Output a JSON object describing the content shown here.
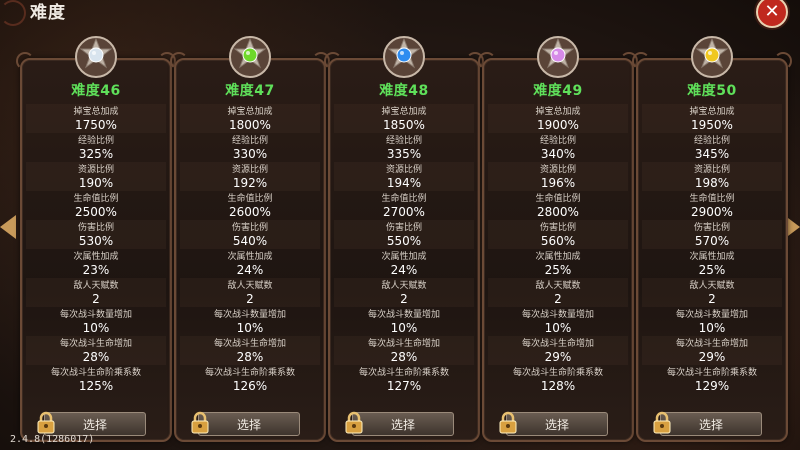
{
  "header": {
    "title": "难度"
  },
  "version": "2.4.8(1286017)",
  "select_label": "选择",
  "cards": [
    {
      "level": "难度46",
      "gem_color": "#d8e4ee",
      "rows": [
        {
          "label": "掉宝总加成",
          "value": "1750%"
        },
        {
          "label": "经验比例",
          "value": "325%"
        },
        {
          "label": "资源比例",
          "value": "190%"
        },
        {
          "label": "生命值比例",
          "value": "2500%"
        },
        {
          "label": "伤害比例",
          "value": "530%"
        },
        {
          "label": "次属性加成",
          "value": "23%"
        },
        {
          "label": "敌人天赋数",
          "value": "2"
        },
        {
          "label": "每次战斗数量增加",
          "value": "10%"
        },
        {
          "label": "每次战斗生命增加",
          "value": "28%"
        },
        {
          "label": "每次战斗生命阶乘系数",
          "value": "125%"
        }
      ]
    },
    {
      "level": "难度47",
      "gem_color": "#6ed82a",
      "rows": [
        {
          "label": "掉宝总加成",
          "value": "1800%"
        },
        {
          "label": "经验比例",
          "value": "330%"
        },
        {
          "label": "资源比例",
          "value": "192%"
        },
        {
          "label": "生命值比例",
          "value": "2600%"
        },
        {
          "label": "伤害比例",
          "value": "540%"
        },
        {
          "label": "次属性加成",
          "value": "24%"
        },
        {
          "label": "敌人天赋数",
          "value": "2"
        },
        {
          "label": "每次战斗数量增加",
          "value": "10%"
        },
        {
          "label": "每次战斗生命增加",
          "value": "28%"
        },
        {
          "label": "每次战斗生命阶乘系数",
          "value": "126%"
        }
      ]
    },
    {
      "level": "难度48",
      "gem_color": "#2e8cf0",
      "rows": [
        {
          "label": "掉宝总加成",
          "value": "1850%"
        },
        {
          "label": "经验比例",
          "value": "335%"
        },
        {
          "label": "资源比例",
          "value": "194%"
        },
        {
          "label": "生命值比例",
          "value": "2700%"
        },
        {
          "label": "伤害比例",
          "value": "550%"
        },
        {
          "label": "次属性加成",
          "value": "24%"
        },
        {
          "label": "敌人天赋数",
          "value": "2"
        },
        {
          "label": "每次战斗数量增加",
          "value": "10%"
        },
        {
          "label": "每次战斗生命增加",
          "value": "28%"
        },
        {
          "label": "每次战斗生命阶乘系数",
          "value": "127%"
        }
      ]
    },
    {
      "level": "难度49",
      "gem_color": "#d68ae8",
      "rows": [
        {
          "label": "掉宝总加成",
          "value": "1900%"
        },
        {
          "label": "经验比例",
          "value": "340%"
        },
        {
          "label": "资源比例",
          "value": "196%"
        },
        {
          "label": "生命值比例",
          "value": "2800%"
        },
        {
          "label": "伤害比例",
          "value": "560%"
        },
        {
          "label": "次属性加成",
          "value": "25%"
        },
        {
          "label": "敌人天赋数",
          "value": "2"
        },
        {
          "label": "每次战斗数量增加",
          "value": "10%"
        },
        {
          "label": "每次战斗生命增加",
          "value": "29%"
        },
        {
          "label": "每次战斗生命阶乘系数",
          "value": "128%"
        }
      ]
    },
    {
      "level": "难度50",
      "gem_color": "#f0c820",
      "rows": [
        {
          "label": "掉宝总加成",
          "value": "1950%"
        },
        {
          "label": "经验比例",
          "value": "345%"
        },
        {
          "label": "资源比例",
          "value": "198%"
        },
        {
          "label": "生命值比例",
          "value": "2900%"
        },
        {
          "label": "伤害比例",
          "value": "570%"
        },
        {
          "label": "次属性加成",
          "value": "25%"
        },
        {
          "label": "敌人天赋数",
          "value": "2"
        },
        {
          "label": "每次战斗数量增加",
          "value": "10%"
        },
        {
          "label": "每次战斗生命增加",
          "value": "29%"
        },
        {
          "label": "每次战斗生命阶乘系数",
          "value": "129%"
        }
      ]
    }
  ],
  "colors": {
    "level_text": "#5fe05a",
    "close_button": "#c0281e",
    "card_border": "#6b4a36"
  },
  "icons": {
    "close": "close-icon",
    "medal": "medal-icon",
    "lock": "lock-icon",
    "nav_left": "arrow-left-icon",
    "nav_right": "arrow-right-icon"
  }
}
